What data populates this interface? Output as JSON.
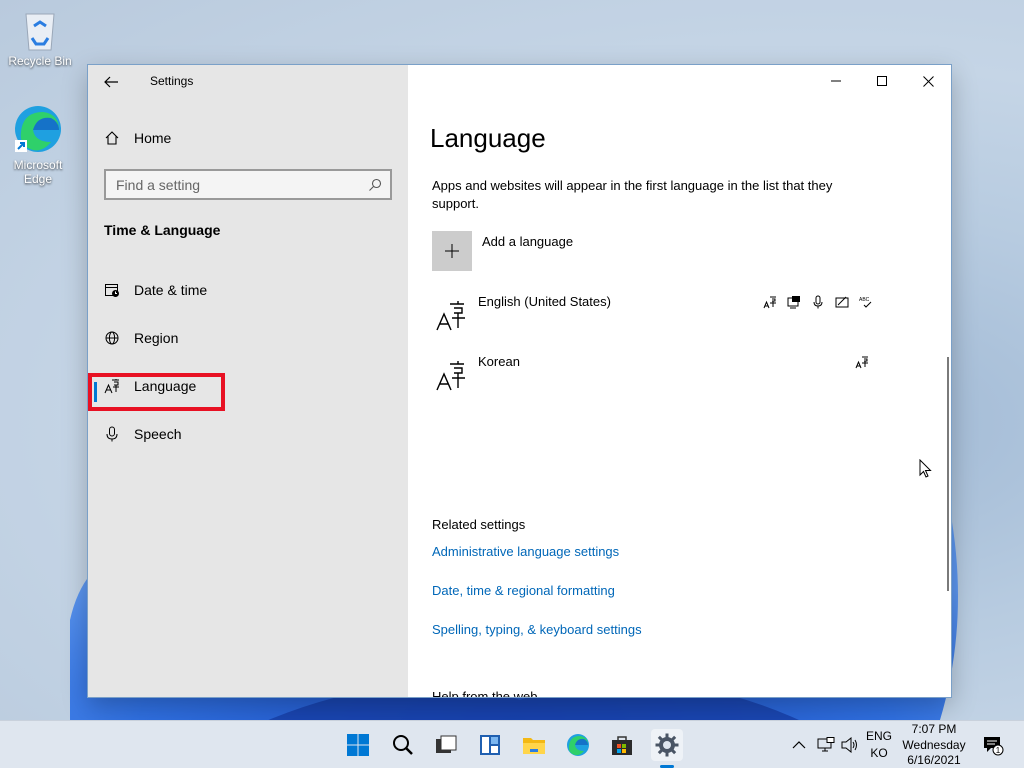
{
  "desktop": {
    "icons": [
      {
        "label": "Recycle Bin"
      },
      {
        "label": "Microsoft Edge"
      }
    ]
  },
  "window": {
    "app_title": "Settings",
    "sidebar": {
      "home_label": "Home",
      "search_placeholder": "Find a setting",
      "section_title": "Time & Language",
      "items": [
        {
          "label": "Date & time",
          "icon": "calendar-clock-icon"
        },
        {
          "label": "Region",
          "icon": "globe-icon"
        },
        {
          "label": "Language",
          "icon": "language-icon",
          "selected": true
        },
        {
          "label": "Speech",
          "icon": "microphone-icon"
        }
      ]
    },
    "content": {
      "title": "Language",
      "description": "Apps and websites will appear in the first language in the list that they support.",
      "add_language_label": "Add a language",
      "languages": [
        {
          "name": "English (United States)",
          "features": [
            "display-language",
            "text-to-speech",
            "speech-recognition",
            "handwriting",
            "basic-typing"
          ]
        },
        {
          "name": "Korean",
          "features": [
            "display-language"
          ]
        }
      ],
      "related_settings_title": "Related settings",
      "related_links": [
        "Administrative language settings",
        "Date, time & regional formatting",
        "Spelling, typing, & keyboard settings"
      ],
      "help_title": "Help from the web"
    }
  },
  "taskbar": {
    "ime_line1": "ENG",
    "ime_line2": "KO",
    "time": "7:07 PM",
    "day": "Wednesday",
    "date": "6/16/2021",
    "notification_count": "1"
  },
  "colors": {
    "accent": "#0078d4",
    "link": "#0067b8",
    "highlight_box": "#e81123",
    "sidebar_bg": "#e6e6e6"
  }
}
